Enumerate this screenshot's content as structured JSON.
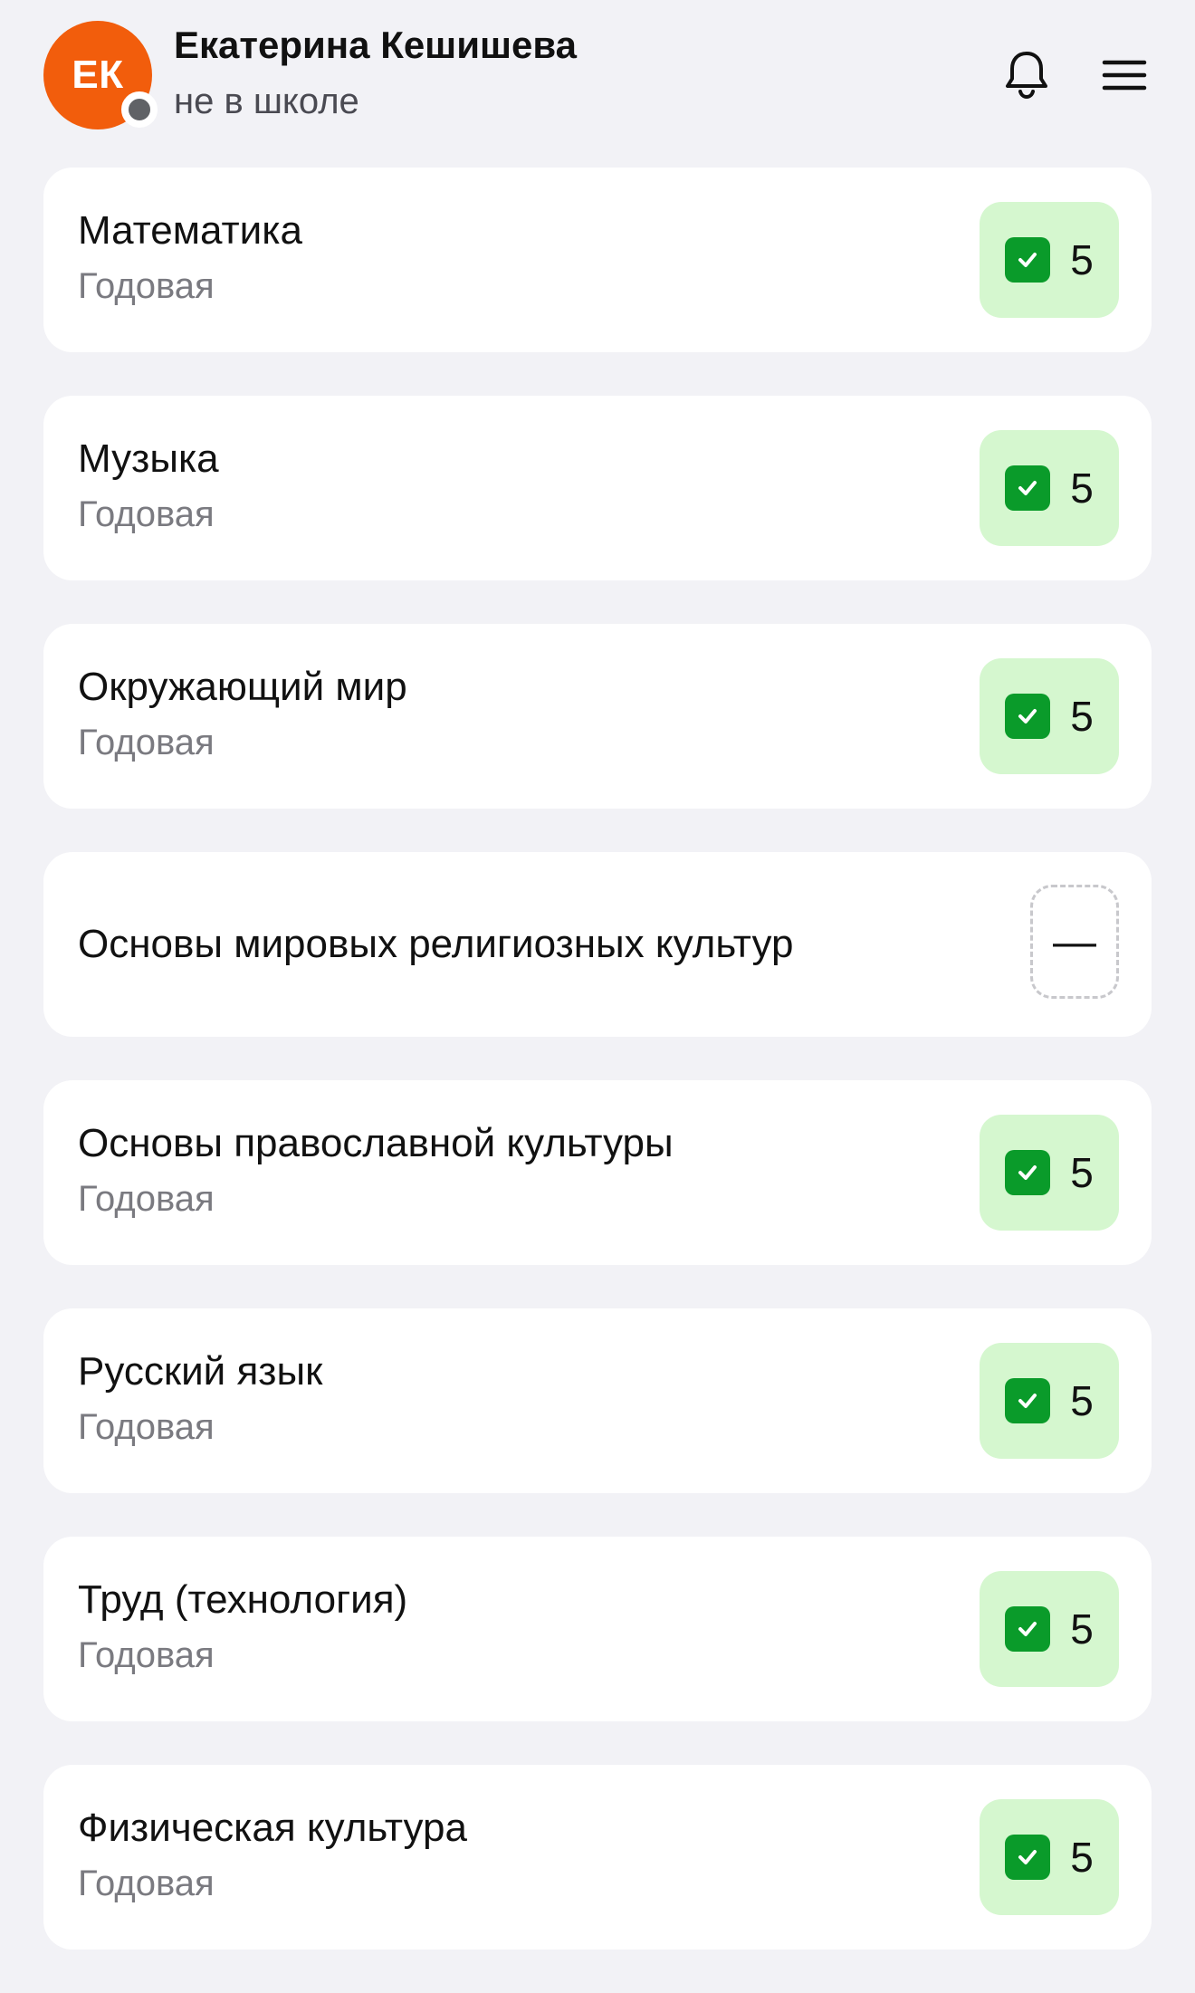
{
  "header": {
    "avatar_initials": "ЕК",
    "user_name": "Екатерина Кешишева",
    "user_status": "не в школе",
    "bell_icon": "bell-icon",
    "menu_icon": "hamburger-menu-icon"
  },
  "colors": {
    "accent": "#f25d0c",
    "grade_bg": "#d5f7cf",
    "check_green": "#0a9b2a",
    "page_bg": "#f2f2f6"
  },
  "subjects": [
    {
      "name": "Математика",
      "period": "Годовая",
      "grade": "5"
    },
    {
      "name": "Музыка",
      "period": "Годовая",
      "grade": "5"
    },
    {
      "name": "Окружающий мир",
      "period": "Годовая",
      "grade": "5"
    },
    {
      "name": "Основы мировых религиозных культур",
      "period": "",
      "grade": "—"
    },
    {
      "name": "Основы православной культуры",
      "period": "Годовая",
      "grade": "5"
    },
    {
      "name": "Русский язык",
      "period": "Годовая",
      "grade": "5"
    },
    {
      "name": "Труд (технология)",
      "period": "Годовая",
      "grade": "5"
    },
    {
      "name": "Физическая культура",
      "period": "Годовая",
      "grade": "5"
    }
  ]
}
